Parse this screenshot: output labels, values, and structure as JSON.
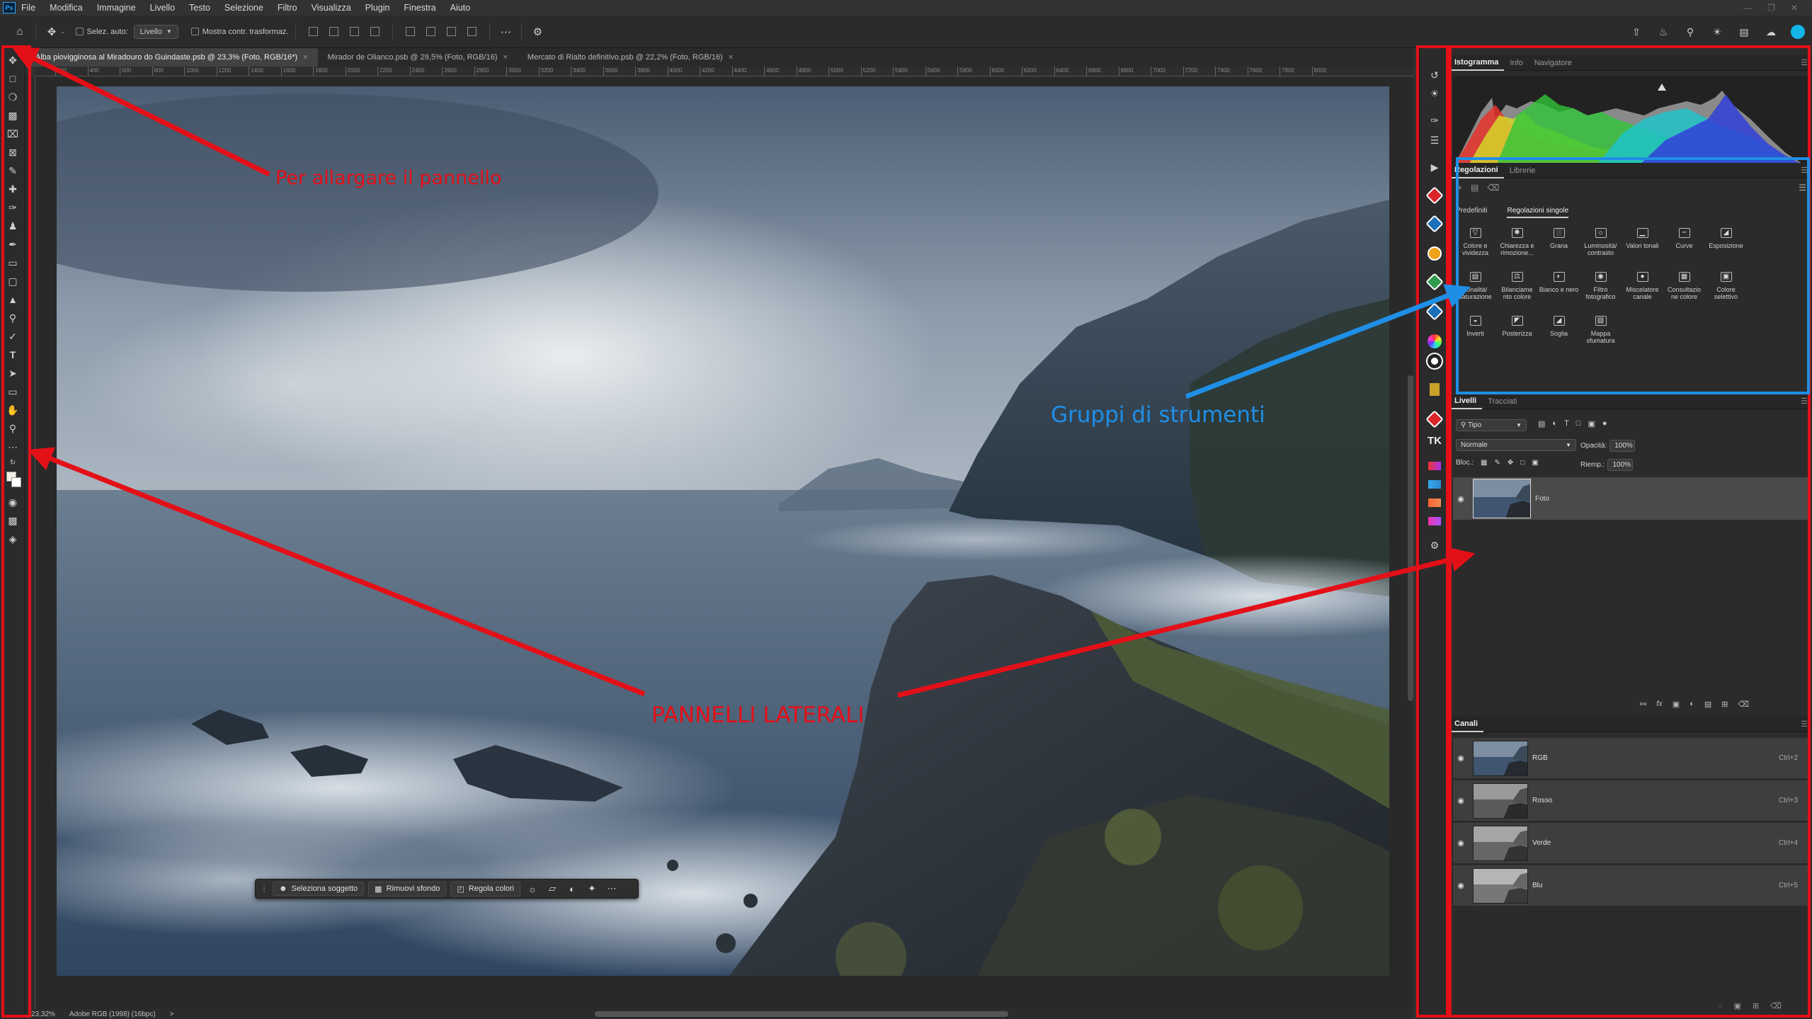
{
  "menubar": {
    "items": [
      "File",
      "Modifica",
      "Immagine",
      "Livello",
      "Testo",
      "Selezione",
      "Filtro",
      "Visualizza",
      "Plugin",
      "Finestra",
      "Aiuto"
    ]
  },
  "options": {
    "auto_select_label": "Selez. auto:",
    "auto_select_value": "Livello",
    "show_transform_label": "Mostra contr. trasformaz."
  },
  "tabs": [
    {
      "label": "Alba piovigginosa al Miradouro do Guindaste.psb @ 23,3% (Foto, RGB/16*)",
      "active": true
    },
    {
      "label": "Mirador de Olianco.psb @ 29,5% (Foto, RGB/16)",
      "active": false
    },
    {
      "label": "Mercato di Rialto definitivo.psb @ 22,2% (Foto, RGB/16)",
      "active": false
    }
  ],
  "ruler_marks": [
    "200",
    "400",
    "600",
    "800",
    "1000",
    "1200",
    "1400",
    "1600",
    "1800",
    "2000",
    "2200",
    "2400",
    "2600",
    "2800",
    "3000",
    "3200",
    "3400",
    "3600",
    "3800",
    "4000",
    "4200",
    "4400",
    "4600",
    "4800",
    "5000",
    "5200",
    "5400",
    "5600",
    "5800",
    "6000",
    "6200",
    "6400",
    "6600",
    "6800",
    "7000",
    "7200",
    "7400",
    "7600",
    "7800",
    "8000"
  ],
  "status": {
    "zoom": "23,32%",
    "profile": "Adobe RGB (1998) (16bpc)",
    "nav_arrow": ">"
  },
  "ctxbar": {
    "select_subject": "Seleziona soggetto",
    "remove_bg": "Rimuovi sfondo",
    "adjust_colors": "Regola colori"
  },
  "panels": {
    "histogram_tabs": [
      "Istogramma",
      "Info",
      "Navigatore"
    ],
    "adjust_tabs": [
      "Regolazioni",
      "Librerie"
    ],
    "adjust_subtabs": [
      "Predefiniti",
      "Regolazioni singole"
    ],
    "adjustments": [
      [
        "Colore e vividezza",
        "Chiarezza e rimozione...",
        "Grana",
        "Luminosità/ contrasto",
        "Valori tonali",
        "Curve",
        "Esposizione"
      ],
      [
        "Tonalità/ saturazione",
        "Bilanciame nto colore",
        "Bianco e nero",
        "Filtro fotografico",
        "Miscelatore canale",
        "Consultazio ne colore",
        "Colore selettivo"
      ],
      [
        "Inverti",
        "Posterizza",
        "Soglia",
        "Mappa sfumatura"
      ]
    ],
    "layers_tabs": [
      "Livelli",
      "Tracciati"
    ],
    "layer_filter": "Tipo",
    "blend_mode": "Normale",
    "opacity_label": "Opacità:",
    "opacity_value": "100%",
    "lock_label": "Bloc.:",
    "fill_label": "Riemp.:",
    "fill_value": "100%",
    "layers": [
      {
        "name": "Foto"
      }
    ],
    "channels_tab": "Canali",
    "channels": [
      {
        "name": "RGB",
        "shortcut": "Ctrl+2"
      },
      {
        "name": "Rosso",
        "shortcut": "Ctrl+3"
      },
      {
        "name": "Verde",
        "shortcut": "Ctrl+4"
      },
      {
        "name": "Blu",
        "shortcut": "Ctrl+5"
      }
    ]
  },
  "annotations": {
    "expand_panel": "Per allargare il pannello",
    "tool_groups": "Gruppi di strumenti",
    "side_panels": "PANNELLI LATERALI",
    "red": "#e41018",
    "blue": "#1f8fe6"
  }
}
